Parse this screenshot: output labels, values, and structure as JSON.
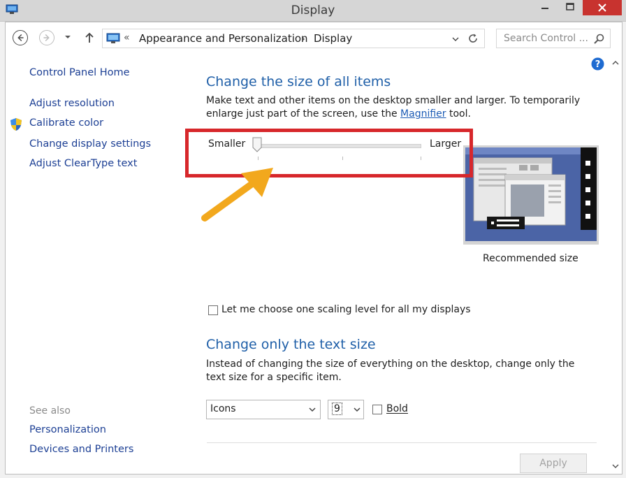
{
  "window": {
    "title": "Display",
    "colors": {
      "title_bar": "#d6d6d6",
      "close_button": "#c8332f",
      "accent_blue": "#1f5fa8",
      "annotation_red": "#d7272b",
      "annotation_arrow": "#f2a81d"
    }
  },
  "navbar": {
    "breadcrumb_prefix": "«",
    "breadcrumb": [
      "Appearance and Personalization",
      "Display"
    ],
    "search_placeholder": "Search Control ..."
  },
  "sidebar": {
    "home": "Control Panel Home",
    "links": [
      "Adjust resolution",
      "Calibrate color",
      "Change display settings",
      "Adjust ClearType text"
    ],
    "see_also_label": "See also",
    "see_also": [
      "Personalization",
      "Devices and Printers"
    ]
  },
  "main": {
    "heading1": "Change the size of all items",
    "para1_before": "Make text and other items on the desktop smaller and larger. To temporarily enlarge just part of the screen, use the ",
    "para1_link": "Magnifier",
    "para1_after": " tool.",
    "slider": {
      "min_label": "Smaller",
      "max_label": "Larger",
      "level": 0
    },
    "preview_caption": "Recommended size",
    "checkbox_label": "Let me choose one scaling level for all my displays",
    "heading2": "Change only the text size",
    "para2": "Instead of changing the size of everything on the desktop, change only the text size for a specific item.",
    "item_select": "Icons",
    "size_select": "9",
    "bold_label": "Bold",
    "apply_label": "Apply"
  }
}
